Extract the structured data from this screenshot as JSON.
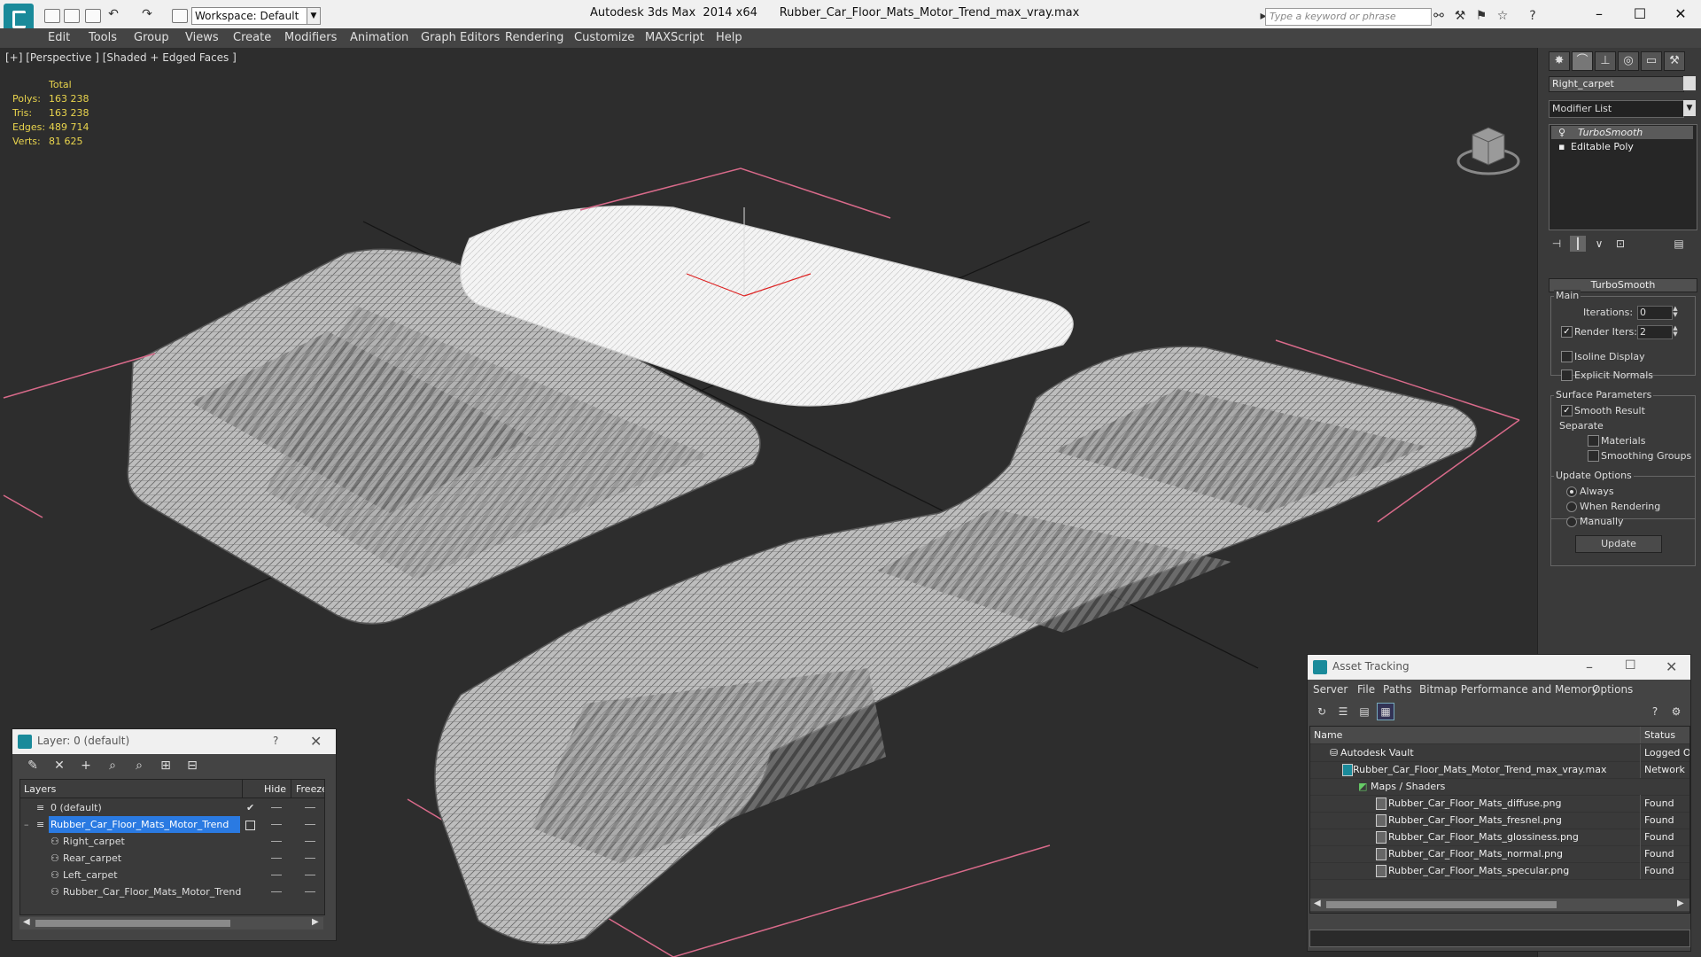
{
  "titlebar": {
    "workspace": "Workspace: Default",
    "app": "Autodesk 3ds Max  2014 x64",
    "file": "Rubber_Car_Floor_Mats_Motor_Trend_max_vray.max",
    "search_placeholder": "Type a keyword or phrase"
  },
  "menu": [
    "Edit",
    "Tools",
    "Group",
    "Views",
    "Create",
    "Modifiers",
    "Animation",
    "Graph Editors",
    "Rendering",
    "Customize",
    "MAXScript",
    "Help"
  ],
  "viewport": {
    "label": "[+] [Perspective ] [Shaded + Edged Faces ]",
    "stats": {
      "header": "Total",
      "rows": [
        {
          "label": "Polys:",
          "value": "163 238"
        },
        {
          "label": "Tris:",
          "value": "163 238"
        },
        {
          "label": "Edges:",
          "value": "489 714"
        },
        {
          "label": "Verts:",
          "value": "81 625"
        }
      ]
    }
  },
  "command_panel": {
    "object_name": "Right_carpet",
    "modifier_list": "Modifier List",
    "stack": [
      "TurboSmooth",
      "Editable Poly"
    ],
    "rollout_title": "TurboSmooth",
    "main_group": "Main",
    "iterations_label": "Iterations:",
    "iterations_value": "0",
    "render_iters_label": "Render Iters:",
    "render_iters_value": "2",
    "isoline": "Isoline Display",
    "explicit": "Explicit Normals",
    "surface_group": "Surface Parameters",
    "smooth_result": "Smooth Result",
    "separate": "Separate",
    "materials": "Materials",
    "smoothing_groups": "Smoothing Groups",
    "update_group": "Update Options",
    "always": "Always",
    "when_rendering": "When Rendering",
    "manually": "Manually",
    "update_btn": "Update"
  },
  "layer_window": {
    "title": "Layer: 0 (default)",
    "help": "?",
    "col_layers": "Layers",
    "col_hide": "Hide",
    "col_freeze": "Freeze",
    "rows": [
      {
        "name": "0 (default)"
      },
      {
        "name": "Rubber_Car_Floor_Mats_Motor_Trend"
      },
      {
        "name": "Right_carpet"
      },
      {
        "name": "Rear_carpet"
      },
      {
        "name": "Left_carpet"
      },
      {
        "name": "Rubber_Car_Floor_Mats_Motor_Trend"
      }
    ]
  },
  "asset_tracking": {
    "title": "Asset Tracking",
    "menu": [
      "Server",
      "File",
      "Paths",
      "Bitmap Performance and Memory",
      "Options"
    ],
    "col_name": "Name",
    "col_status": "Status",
    "rows": [
      {
        "name": "Autodesk Vault",
        "status": "Logged O"
      },
      {
        "name": "Rubber_Car_Floor_Mats_Motor_Trend_max_vray.max",
        "status": "Network"
      },
      {
        "name": "Maps / Shaders",
        "status": ""
      },
      {
        "name": "Rubber_Car_Floor_Mats_diffuse.png",
        "status": "Found"
      },
      {
        "name": "Rubber_Car_Floor_Mats_fresnel.png",
        "status": "Found"
      },
      {
        "name": "Rubber_Car_Floor_Mats_glossiness.png",
        "status": "Found"
      },
      {
        "name": "Rubber_Car_Floor_Mats_normal.png",
        "status": "Found"
      },
      {
        "name": "Rubber_Car_Floor_Mats_specular.png",
        "status": "Found"
      }
    ]
  },
  "colors": {
    "viewport_bg": "#2d2d2d",
    "stats": "#e9d44d",
    "selection": "#2a7ae2",
    "bbox": "#d86a8a"
  }
}
